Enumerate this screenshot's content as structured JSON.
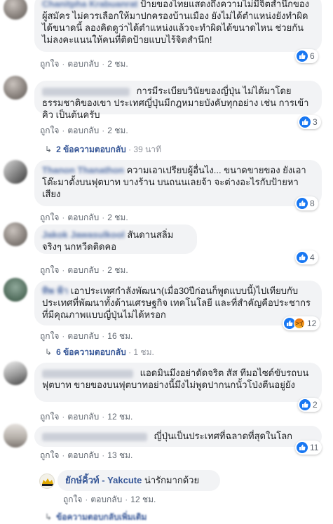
{
  "common": {
    "like": "ถูกใจ",
    "reply": "ตอบกลับ",
    "dot": "·"
  },
  "comments": [
    {
      "name": "Chanitpha Krabuanrat",
      "text": "ป้ายของไทยแสดงถึงความไม่มีจิตสำนึกของผู้สมัคร ไม่ควรเลือกให้มาปกครองบ้านเมือง ยังไม่ได้ตำแหน่งยังทำผิดได้ขนาดนี้ ลองคิดดูว่าได้ตำแหน่งแล้วจะทำผิดได้ขนาดไหน ช่วยกันไม่ลงคะแนนให้คนที่ติดป้ายแบบไร้จิตสำนึก!",
      "time": "2 ชม.",
      "reactions": "6"
    },
    {
      "name": "",
      "text": "การมีระเบียบวินัยของญี่ปุ่น ไม่ได้มาโดยธรรมชาติของเขา ประเทศญี่ปุ่นมีกฎหมายบังคับทุกอย่าง เช่น การเข้าคิว เป็นต้นครับ",
      "time": "2 ชม.",
      "reactions": "3",
      "replies_label": "2 ข้อความตอบกลับ",
      "replies_time": "39 นาที"
    },
    {
      "name": "Thanon Thanathon",
      "text": "ความเอาเปรียบผู้อื่นไง... ขนาดขายของ ยังเอาโต๊ะมาตั้งบนฟุตบาท บางร้าน บนถนนเลยจ้า จะต่างอะไรกับป้ายหาเสียง",
      "time": "2 ชม.",
      "reactions": "8"
    },
    {
      "name": "Jakok Jawasulkool",
      "text": "สันดานสลิ่มจริงๆ นกหวีดติดคอ",
      "time": "2 ชม.",
      "reactions": "4"
    },
    {
      "name": "ทิพ ฟ้า",
      "text": "เอาประเทศกำลังพัฒนา(เมื่อ30ปีก่อนก็พูดแบบนี้)ไปเทียบกับประเทศที่พัฒนาทั้งด้านเศรษฐกิจ เทคโนโลยี และที่สำคัญคือประชากรที่มีคุณภาพแบบญี่ปุ่นไม่ได้หรอก",
      "time": "16 ชม.",
      "reactions": "12",
      "replies_label": "6 ข้อความตอบกลับ",
      "replies_time": "1 ชม."
    },
    {
      "name": "",
      "text": "แอดมินมึงอย่าดัดจริต สัส ทีมอไซด์ขับรถบนฟุตบาท ขายของบนฟุตบาทอย่างนี้มึงไม่พูดปากนกนั้วโป่งตีนอยู่ยัง",
      "time": "12 ชม.",
      "reactions": "2"
    },
    {
      "name": "",
      "text": "ญี่ปุ่นเป็นประเทศที่ฉลาดที่สุดในโลก",
      "time": "13 ชม.",
      "reactions": "11"
    }
  ],
  "reply": {
    "name": "ยักษ์คิ้วท์ - Yakcute",
    "text": "น่ารักมากด้วย",
    "time": "12 ชม."
  },
  "bottom_replies": {
    "label": "ข้อความตอบกลับเพิ่มเติม"
  }
}
